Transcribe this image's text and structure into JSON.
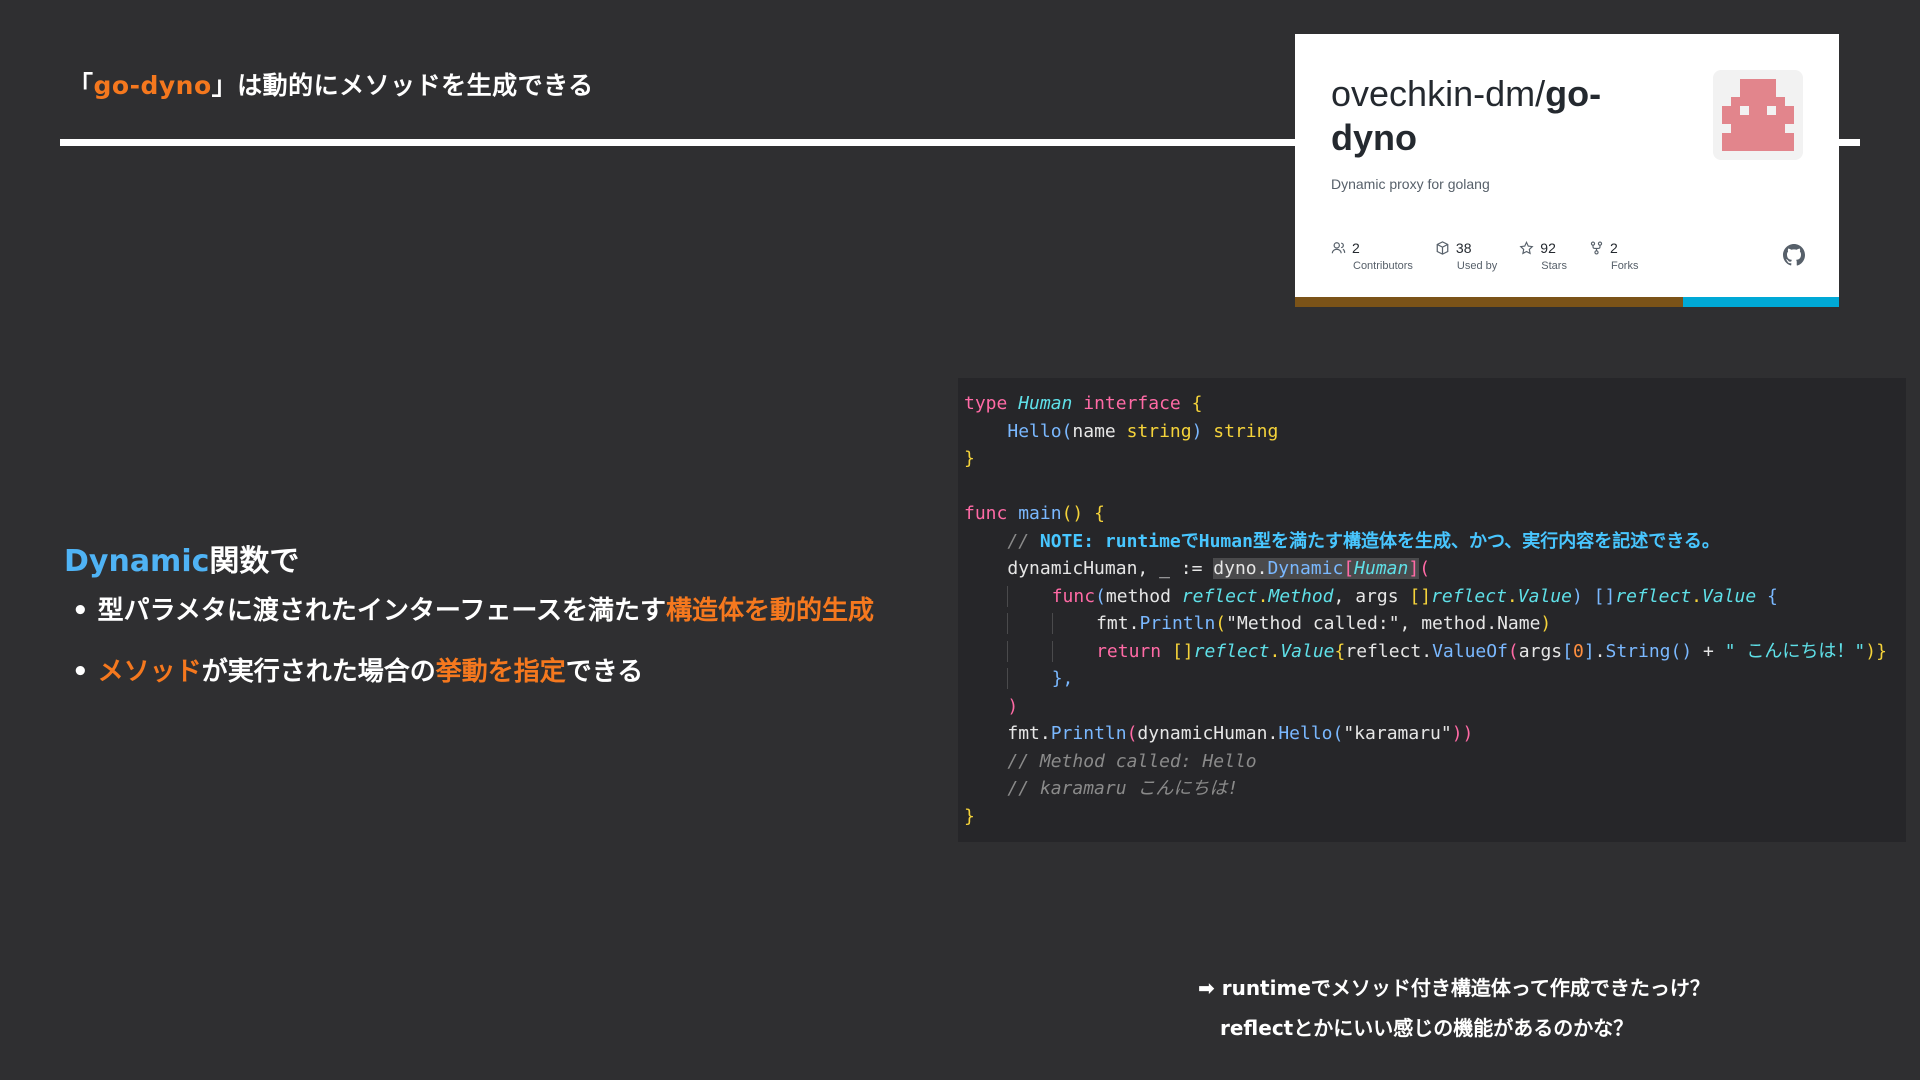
{
  "slide": {
    "title_open": "「",
    "title_hl": "go-dyno",
    "title_rest": "」は動的にメソッドを生成できる"
  },
  "github": {
    "owner": "ovechkin-dm/",
    "repo": "go-dyno",
    "description": "Dynamic proxy for golang",
    "stats": [
      {
        "icon": "people-icon",
        "value": "2",
        "label": "Contributors"
      },
      {
        "icon": "package-icon",
        "value": "38",
        "label": "Used by"
      },
      {
        "icon": "star-icon",
        "value": "92",
        "label": "Stars"
      },
      {
        "icon": "fork-icon",
        "value": "2",
        "label": "Forks"
      }
    ],
    "colors": {
      "lang_primary": "#7b5318",
      "lang_secondary": "#00a9d6",
      "avatar": "#e2858c"
    }
  },
  "lead": {
    "hl": "Dynamic",
    "rest": "関数で"
  },
  "bullets": [
    {
      "a": "型パラメタに渡されたインターフェースを満たす",
      "hl": "構造体を動的生成",
      "b": ""
    },
    {
      "a": "",
      "hl": "メソッド",
      "b": "が実行された場合の",
      "hl2": "挙動を指定",
      "c": "できる"
    }
  ],
  "code": {
    "l1": {
      "t1": "type",
      "t2": "Human",
      "t3": "interface",
      "t4": "{"
    },
    "l2": {
      "t1": "Hello",
      "t2": "(",
      "t3": "name ",
      "t4": "string",
      "t5": ")",
      "t6": " string"
    },
    "l3": {
      "t1": "}"
    },
    "l5": {
      "t1": "func",
      "t2": "main",
      "t3": "()",
      "t4": "{"
    },
    "l6": {
      "t1": "// ",
      "t2": "NOTE:",
      "t3": " runtimeでHuman型を満たす構造体を生成、かつ、実行内容を記述できる。"
    },
    "l7": {
      "t1": "dynamicHuman, _ := ",
      "t2": "dyno.",
      "t3": "Dynamic",
      "t4": "[",
      "t5": "Human",
      "t6": "]",
      "t7": "("
    },
    "l8": {
      "t1": "func",
      "t2": "(",
      "t3": "method ",
      "t4": "reflect",
      "t5": ".",
      "t6": "Method",
      "t7": ", args ",
      "t8": "[]",
      "t9": "reflect",
      "t10": ".",
      "t11": "Value",
      "t12": ")",
      "t13": " []",
      "t14": "reflect",
      "t15": ".",
      "t16": "Value",
      "t17": " {"
    },
    "l9": {
      "t1": "fmt.",
      "t2": "Println",
      "t3": "(",
      "t4": "\"Method called:\"",
      "t5": ", method.Name",
      "t6": ")"
    },
    "l10": {
      "t1": "return ",
      "t2": "[]",
      "t3": "reflect",
      "t4": ".",
      "t5": "Value",
      "t6": "{",
      "t7": "reflect.",
      "t8": "ValueOf",
      "t9": "(",
      "t10": "args",
      "t11": "[",
      "t12": "0",
      "t13": "]",
      "t14": ".",
      "t15": "String",
      "t16": "()",
      "t17": " + ",
      "t18": "\" こんにちは！\"",
      "t19": ")}"
    },
    "l11": {
      "t1": "},"
    },
    "l12": {
      "t1": ")"
    },
    "l13": {
      "t1": "fmt.",
      "t2": "Println",
      "t3": "(",
      "t4": "dynamicHuman.",
      "t5": "Hello",
      "t6": "(",
      "t7": "\"karamaru\"",
      "t8": "))"
    },
    "l14": {
      "t1": "// Method called: Hello"
    },
    "l15": {
      "t1": "// karamaru こんにちは!"
    },
    "l16": {
      "t1": "}"
    }
  },
  "footnote": {
    "line1": "➡ runtimeでメソッド付き構造体って作成できたっけ？",
    "line2": "reflectとかにいい感じの機能があるのかな？"
  }
}
